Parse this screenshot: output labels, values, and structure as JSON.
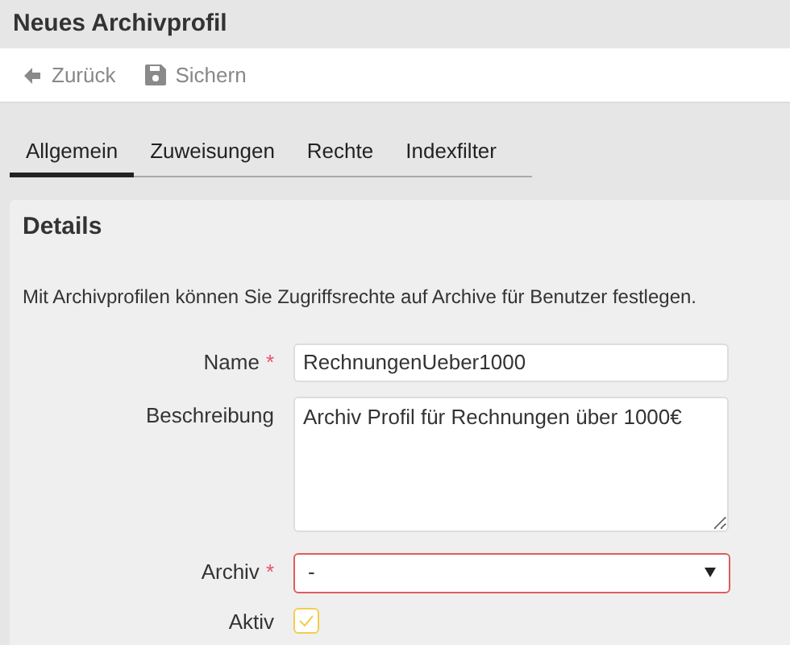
{
  "window": {
    "title": "Neues Archivprofil"
  },
  "toolbar": [
    {
      "kind": "back",
      "label": "Zurück"
    },
    {
      "kind": "save",
      "label": "Sichern"
    }
  ],
  "tabs": [
    {
      "label": "Allgemein",
      "selected": true
    },
    {
      "label": "Zuweisungen",
      "selected": false
    },
    {
      "label": "Rechte",
      "selected": false
    },
    {
      "label": "Indexfilter",
      "selected": false
    }
  ],
  "panel": {
    "title": "Details",
    "description": "Mit Archivprofilen können Sie Zugriffsrechte auf Archive für Benutzer festlegen.",
    "fields": [
      {
        "kind": "text",
        "label": "Name",
        "required_mark": "*",
        "value": "RechnungenUeber1000"
      },
      {
        "kind": "textarea",
        "label": "Beschreibung",
        "value": "Archiv Profil für Rechnungen über 1000€"
      },
      {
        "kind": "select",
        "label": "Archiv",
        "required_mark": "*",
        "invalid": true,
        "value": "-"
      },
      {
        "kind": "checkbox",
        "label": "Aktiv",
        "checked": true
      }
    ]
  }
}
